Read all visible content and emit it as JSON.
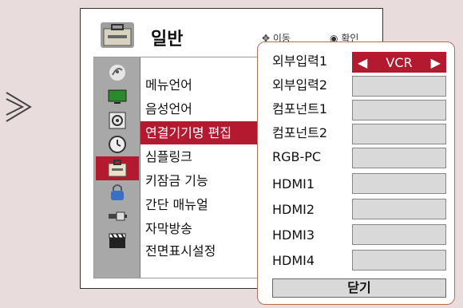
{
  "menu": {
    "title": "일반",
    "hint_move": "이동",
    "hint_ok": "확인",
    "items": [
      {
        "label": "메뉴언어",
        "icon": "satellite-dish-icon"
      },
      {
        "label": "음성언어",
        "icon": "tv-picture-icon"
      },
      {
        "label": "연결기기명 편집",
        "icon": "speaker-icon"
      },
      {
        "label": "심플링크",
        "icon": "clock-icon"
      },
      {
        "label": "키잠금 기능",
        "icon": "toolbox-icon"
      },
      {
        "label": "간단 매뉴얼",
        "icon": "lock-icon"
      },
      {
        "label": "자막방송",
        "icon": "connector-icon"
      },
      {
        "label": "전면표시설정",
        "icon": "clapperboard-icon"
      }
    ],
    "colons": [
      ":",
      ":",
      ":",
      ":",
      ":"
    ],
    "active_index": 2
  },
  "popup": {
    "inputs": [
      {
        "label": "외부입력1",
        "value": "VCR"
      },
      {
        "label": "외부입력2",
        "value": ""
      },
      {
        "label": "컴포넌트1",
        "value": ""
      },
      {
        "label": "컴포넌트2",
        "value": ""
      },
      {
        "label": "RGB-PC",
        "value": ""
      },
      {
        "label": "HDMI1",
        "value": ""
      },
      {
        "label": "HDMI2",
        "value": ""
      },
      {
        "label": "HDMI3",
        "value": ""
      },
      {
        "label": "HDMI4",
        "value": ""
      }
    ],
    "arrow_left": "◀",
    "arrow_right": "▶",
    "close_label": "닫기"
  },
  "colors": {
    "accent": "#b31a2f",
    "popup_border": "#b96d57"
  }
}
